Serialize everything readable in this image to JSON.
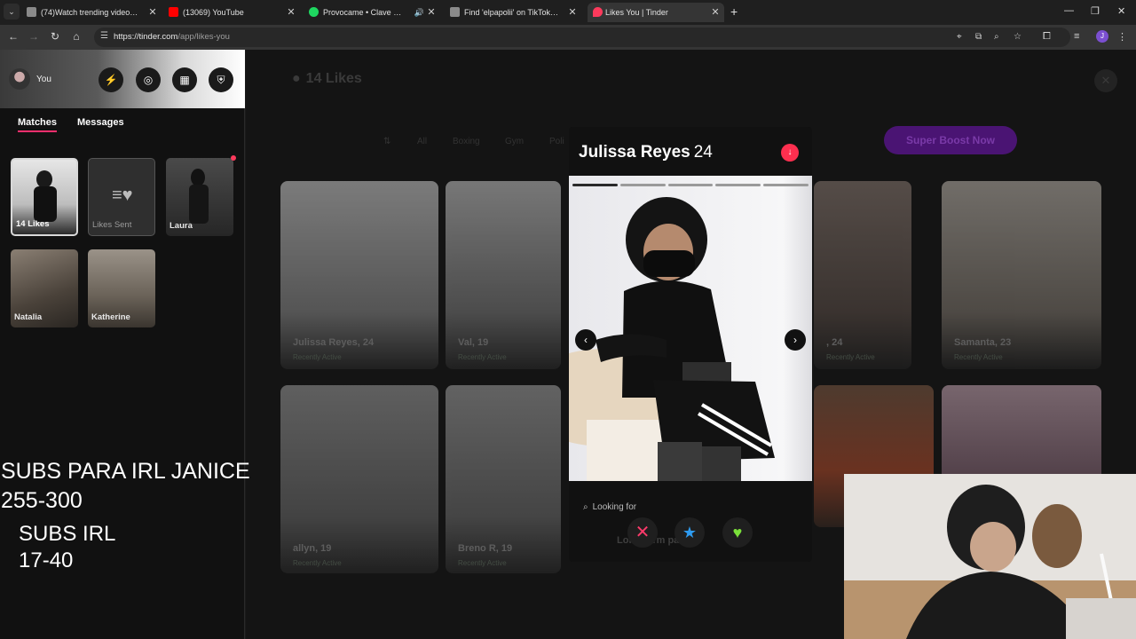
{
  "browser": {
    "tabs": [
      {
        "title": "(74)Watch trending videos for y",
        "favicon_color": "#8a8a8a",
        "active": false,
        "audio": false
      },
      {
        "title": "(13069) YouTube",
        "favicon_color": "#ff0000",
        "active": false,
        "audio": false
      },
      {
        "title": "Provocame • Clave Suprem",
        "favicon_color": "#1ed760",
        "active": false,
        "audio": true
      },
      {
        "title": "Find 'elpapolii' on TikTok | TikTo",
        "favicon_color": "#8a8a8a",
        "active": false,
        "audio": false
      },
      {
        "title": "Likes You | Tinder",
        "favicon_color": "#fd3a5c",
        "active": true,
        "audio": false
      }
    ],
    "url_host": "https://tinder.com",
    "url_path": "/app/likes-you"
  },
  "sidebar": {
    "me_label": "You",
    "tabs": [
      {
        "label": "Matches",
        "active": true
      },
      {
        "label": "Messages",
        "active": false
      }
    ],
    "matches": [
      {
        "name": "14 Likes"
      },
      {
        "name": "Likes Sent"
      },
      {
        "name": "Laura"
      },
      {
        "name": "Natalia"
      },
      {
        "name": "Katherine"
      }
    ]
  },
  "overlay": {
    "line1": "SUBS PARA IRL JANICE",
    "line2": "255-300",
    "line3": "SUBS IRL",
    "line4": "17-40"
  },
  "main": {
    "title": "14 Likes",
    "filters": [
      "All",
      "Boxing",
      "Gym",
      "Poli"
    ],
    "boost_label": "Super Boost Now",
    "cards": [
      {
        "name": "Julissa Reyes, 24",
        "status": "Recently Active"
      },
      {
        "name": "Val, 19",
        "status": "Recently Active"
      },
      {
        "name": ", 24",
        "status": "Recently Active"
      },
      {
        "name": "Samanta, 23",
        "status": "Recently Active"
      },
      {
        "name": "allyn, 19",
        "status": "Recently Active"
      },
      {
        "name": "Breno R, 19",
        "status": "Recently Active"
      },
      {
        "name": "",
        "status": ""
      },
      {
        "name": "",
        "status": ""
      }
    ]
  },
  "modal": {
    "name": "Julissa Reyes",
    "age": "24",
    "looking_for_label": "Looking for",
    "looking_for_value": "Long-term partne",
    "photo_count": 5,
    "photo_index": 1
  },
  "colors": {
    "tinder_accent": "#fd2f6d",
    "boost_purple": "#a855f7"
  }
}
